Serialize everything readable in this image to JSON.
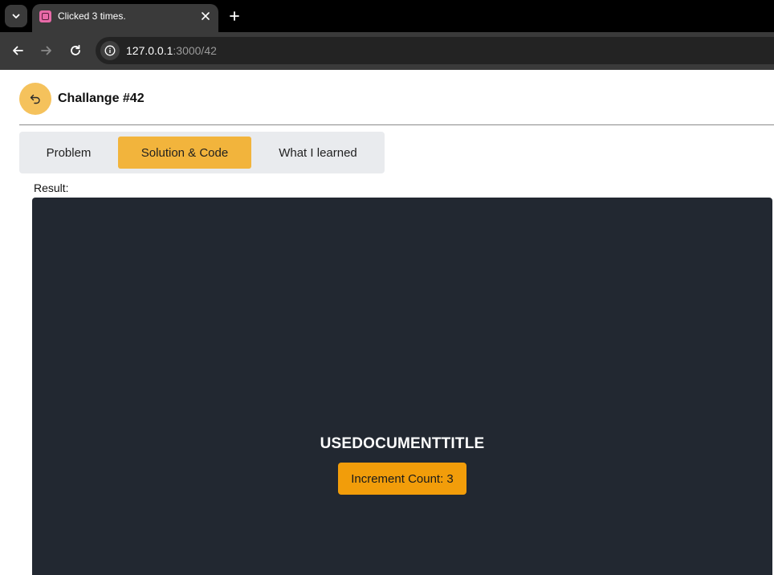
{
  "browser": {
    "tab": {
      "title": "Clicked 3 times."
    },
    "address": {
      "host": "127.0.0.1",
      "path": ":3000/42"
    }
  },
  "header": {
    "title": "Challange #42"
  },
  "tabs": [
    {
      "label": "Problem",
      "active": false
    },
    {
      "label": "Solution & Code",
      "active": true
    },
    {
      "label": "What I learned",
      "active": false
    }
  ],
  "result": {
    "label": "Result:",
    "demo_title": "USEDOCUMENTTITLE",
    "button_label": "Increment Count: 3"
  },
  "colors": {
    "accent": "#f2b43c",
    "back_button": "#f5c25c",
    "demo_button": "#f29d0a",
    "panel_bg": "#222831"
  }
}
